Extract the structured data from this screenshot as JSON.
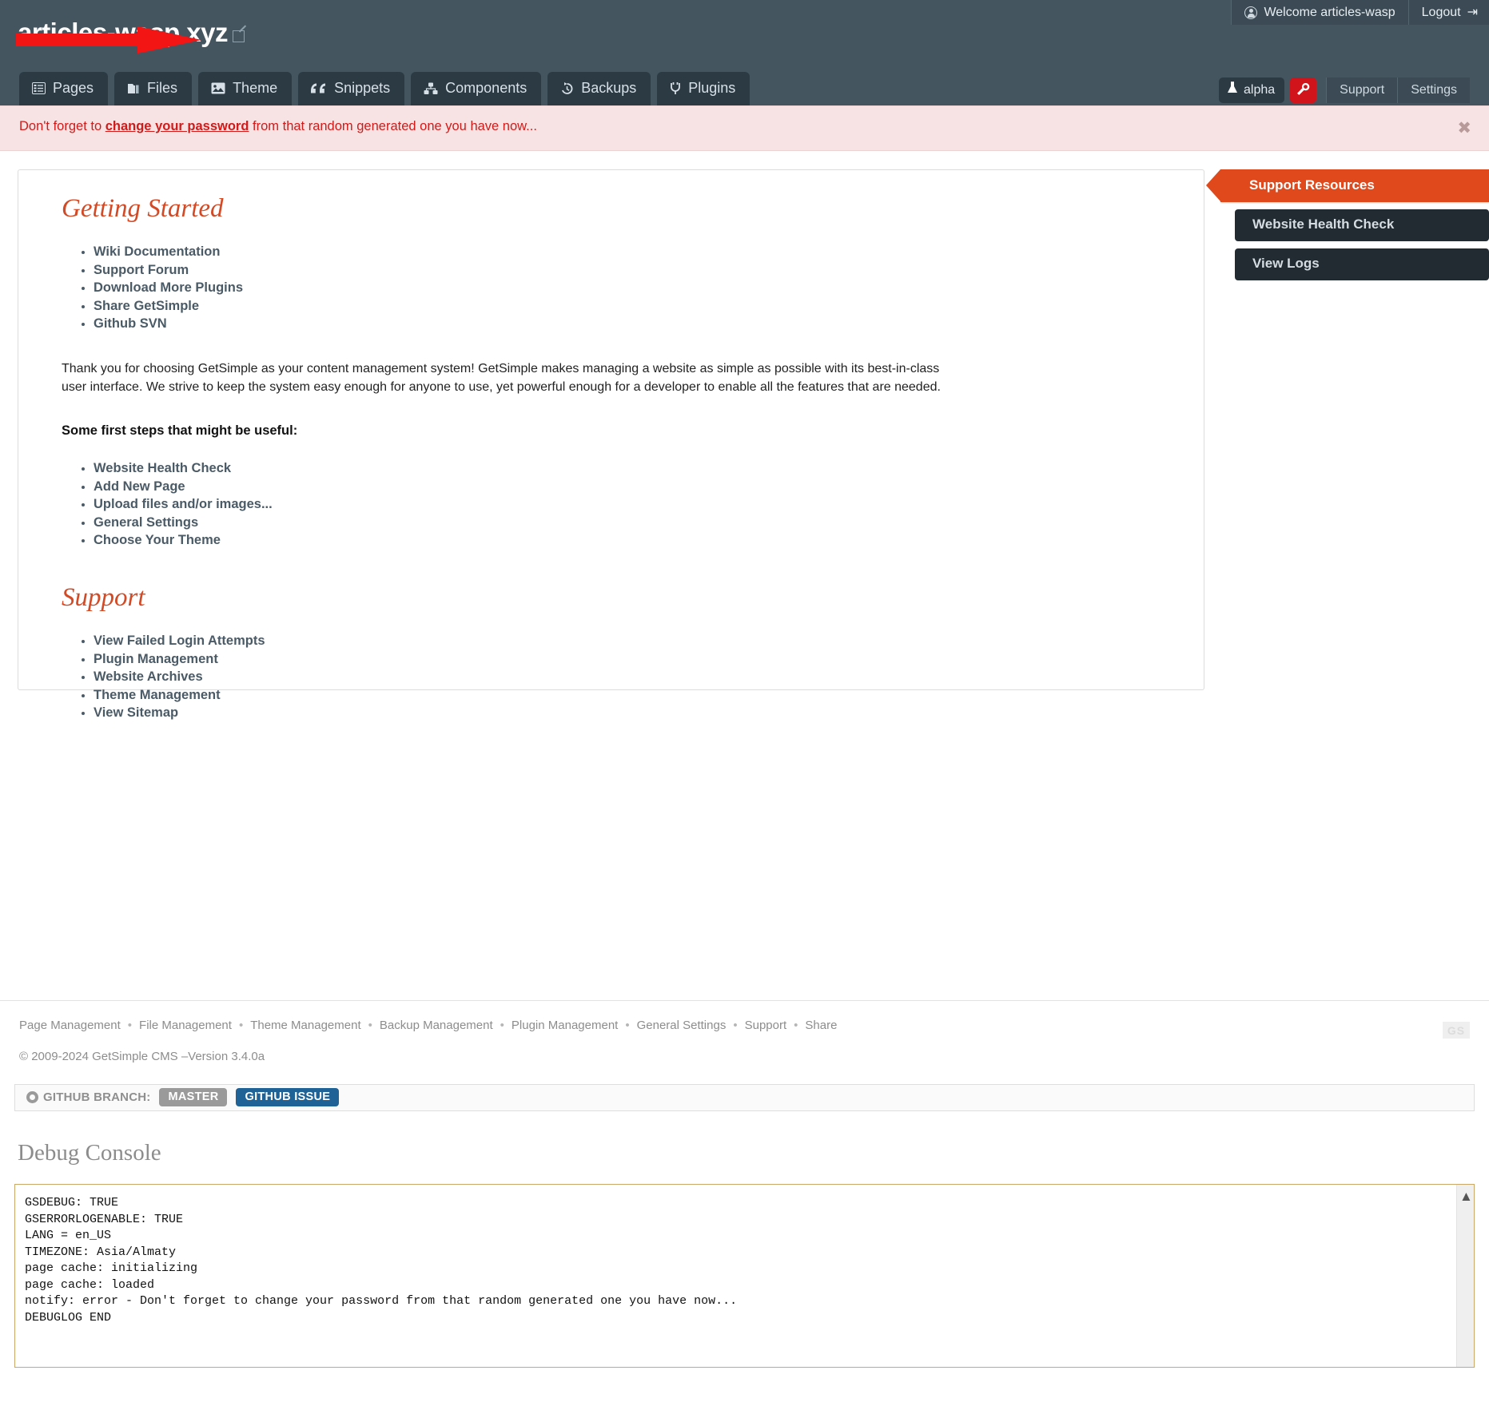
{
  "header": {
    "site_title": "articles-wasp.xyz",
    "edit_icon": "external-edit-icon",
    "welcome_text": "Welcome articles-wasp",
    "welcome_icon": "user-circle-icon",
    "logout_label": "Logout",
    "logout_icon": "logout-icon",
    "accent_color": "#455560"
  },
  "nav": {
    "tabs": [
      {
        "label": "Pages",
        "icon": "pages-icon"
      },
      {
        "label": "Files",
        "icon": "files-icon"
      },
      {
        "label": "Theme",
        "icon": "image-icon"
      },
      {
        "label": "Snippets",
        "icon": "quote-icon"
      },
      {
        "label": "Components",
        "icon": "components-icon"
      },
      {
        "label": "Backups",
        "icon": "history-icon"
      },
      {
        "label": "Plugins",
        "icon": "plug-icon"
      }
    ],
    "alpha_badge": {
      "label": "alpha",
      "icon": "flask-icon"
    },
    "wrench_button": {
      "icon": "wrench-icon",
      "color": "#d1141b"
    },
    "support_label": "Support",
    "settings_label": "Settings"
  },
  "alert": {
    "prefix": "Don't forget to ",
    "link": "change your password",
    "suffix": " from that random generated one you have now...",
    "close_icon": "close-icon",
    "text_color": "#d11a1a",
    "bg_color": "#f7e3e3"
  },
  "main": {
    "getting_started": {
      "heading": "Getting Started",
      "links": [
        "Wiki Documentation",
        "Support Forum",
        "Download More Plugins",
        "Share GetSimple",
        "Github SVN"
      ],
      "paragraph": "Thank you for choosing GetSimple as your content management system! GetSimple makes managing a website as simple as possible with its best-in-class user interface. We strive to keep the system easy enough for anyone to use, yet powerful enough for a developer to enable all the features that are needed.",
      "steps_heading": "Some first steps that might be useful:",
      "steps": [
        "Website Health Check",
        "Add New Page",
        "Upload files and/or images...",
        "General Settings",
        "Choose Your Theme"
      ]
    },
    "support": {
      "heading": "Support",
      "links": [
        "View Failed Login Attempts",
        "Plugin Management",
        "Website Archives",
        "Theme Management",
        "View Sitemap"
      ]
    }
  },
  "sidebar": {
    "header": "Support Resources",
    "header_color": "#e0491c",
    "buttons": [
      "Website Health Check",
      "View Logs"
    ]
  },
  "footer": {
    "links": [
      "Page Management",
      "File Management",
      "Theme Management",
      "Backup Management",
      "Plugin Management",
      "General Settings",
      "Support",
      "Share"
    ],
    "copyright": "© 2009-2024 GetSimple CMS –Version 3.4.0a",
    "logo_text": "GS"
  },
  "github_bar": {
    "icon": "github-icon",
    "label": "GITHUB BRANCH:",
    "branch_badge": "MASTER",
    "issue_badge": "GITHUB ISSUE",
    "branch_color": "#9a9a9a",
    "issue_color": "#1e6296"
  },
  "debug": {
    "title": "Debug Console",
    "lines": "GSDEBUG: TRUE\nGSERRORLOGENABLE: TRUE\nLANG = en_US\nTIMEZONE: Asia/Almaty\npage cache: initializing\npage cache: loaded\nnotify: error - Don't forget to change your password from that random generated one you have now...\nDEBUGLOG END",
    "scroll_up_icon": "chevron-up-icon"
  }
}
